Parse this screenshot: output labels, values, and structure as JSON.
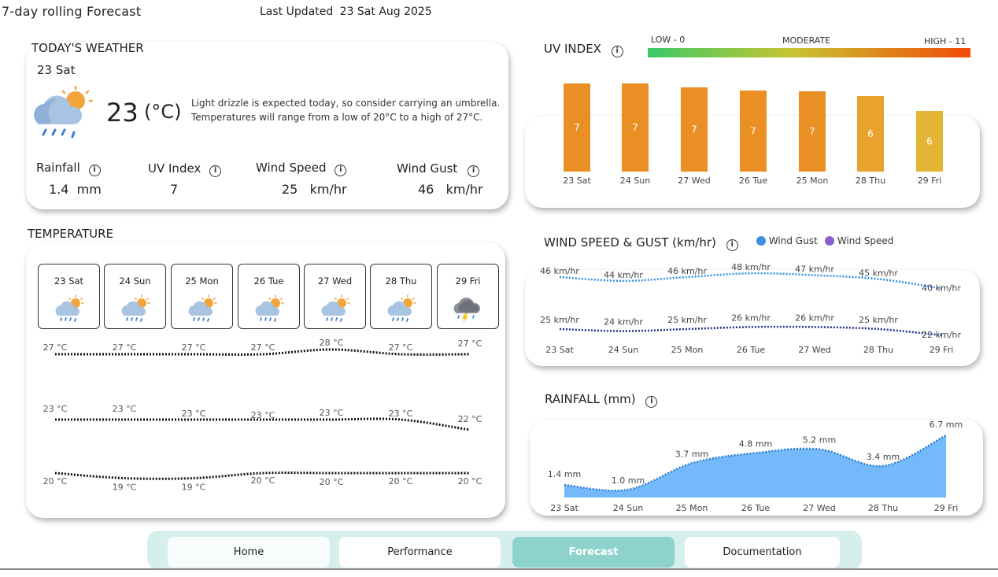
{
  "header": {
    "title": "7-day rolling Forecast",
    "last_updated_label": "Last Updated",
    "last_updated_value": "23 Sat  Aug 2025"
  },
  "today": {
    "section_title": "TODAY'S WEATHER",
    "date": "23 Sat",
    "temp": "23",
    "unit": "(°C)",
    "description_1": "Light drizzle is expected today, so consider carrying an umbrella.",
    "description_2": "Temperatures will range from a low of 20°C to a high of 27°C.",
    "metrics": [
      {
        "label": "Rainfall",
        "value": "1.4",
        "unit": "mm"
      },
      {
        "label": "UV Index",
        "value": "7",
        "unit": ""
      },
      {
        "label": "Wind Speed",
        "value": "25",
        "unit": "km/hr"
      },
      {
        "label": "Wind Gust",
        "value": "46",
        "unit": "km/hr"
      }
    ]
  },
  "temperature": {
    "section_title": "TEMPERATURE",
    "days": [
      "23 Sat",
      "24 Sun",
      "25 Mon",
      "26 Tue",
      "27 Wed",
      "28 Thu",
      "29 Fri"
    ],
    "icons": [
      "rain-sun-icon",
      "rain-sun-icon",
      "rain-sun-icon",
      "rain-sun-icon",
      "rain-sun-icon",
      "rain-sun-icon",
      "thunderstorm-icon"
    ],
    "max": [
      27,
      27,
      27,
      27,
      28,
      27,
      27
    ],
    "mean": [
      23,
      23,
      23,
      23,
      23,
      23,
      22
    ],
    "min": [
      20,
      19,
      19,
      20,
      20,
      20,
      20
    ],
    "max_labels": [
      "27 °C",
      "27 °C",
      "27 °C",
      "27 °C",
      "28 °C",
      "27 °C",
      "27 °C"
    ],
    "mean_labels": [
      "23 °C",
      "23 °C",
      "23 °C",
      "23 °C",
      "23 °C",
      "23 °C",
      "22 °C"
    ],
    "min_labels": [
      "20 °C",
      "19 °C",
      "19 °C",
      "20 °C",
      "20 °C",
      "20 °C",
      "20 °C"
    ]
  },
  "uv": {
    "section_title": "UV INDEX",
    "scale_low": "LOW - 0",
    "scale_mid": "MODERATE",
    "scale_high": "HIGH - 11",
    "colors": {
      "low": "#3cc968",
      "mid": "#c8c431",
      "high": "#f24a08"
    }
  },
  "wind": {
    "section_title": "WIND SPEED & GUST (km/hr)",
    "legend_gust": "Wind Gust",
    "legend_speed": "Wind Speed",
    "colors": {
      "gust": "#3f8fe0",
      "speed": "#8a5fcc",
      "gust_line": "#2f8fe8",
      "speed_line": "#1d2e8f"
    }
  },
  "rain": {
    "section_title": "RAINFALL (mm)",
    "area_color": "#74b9f9",
    "line_color": "#2f7fd0"
  },
  "nav": {
    "items": [
      "Home",
      "Performance",
      "Forecast",
      "Documentation"
    ],
    "active": "Forecast"
  },
  "chart_data": [
    {
      "type": "bar",
      "title": "UV INDEX",
      "categories": [
        "23 Sat",
        "24 Sun",
        "27 Wed",
        "26 Tue",
        "25 Mon",
        "28 Thu",
        "29 Fri"
      ],
      "values": [
        7,
        7,
        7,
        7,
        7,
        6,
        6
      ],
      "labels": [
        "7",
        "7",
        "7",
        "7",
        "7",
        "6",
        "6"
      ],
      "ylim": [
        0,
        7.6
      ]
    },
    {
      "type": "line",
      "title": "WIND SPEED & GUST (km/hr)",
      "categories": [
        "23 Sat",
        "24 Sun",
        "25 Mon",
        "26 Tue",
        "27 Wed",
        "28 Thu",
        "29 Fri"
      ],
      "series": [
        {
          "name": "Wind Gust",
          "values": [
            46,
            44,
            46,
            48,
            47,
            45,
            40
          ],
          "labels": [
            "46 km/hr",
            "44 km/hr",
            "46 km/hr",
            "48 km/hr",
            "47 km/hr",
            "45 km/hr",
            "40 km/hr"
          ]
        },
        {
          "name": "Wind Speed",
          "values": [
            25,
            24,
            25,
            26,
            26,
            25,
            22
          ],
          "labels": [
            "25 km/hr",
            "24 km/hr",
            "25 km/hr",
            "26 km/hr",
            "26 km/hr",
            "25 km/hr",
            "22 km/hr"
          ]
        }
      ]
    },
    {
      "type": "area",
      "title": "RAINFALL (mm)",
      "categories": [
        "23 Sat",
        "24 Sun",
        "25 Mon",
        "26 Tue",
        "27 Wed",
        "28 Thu",
        "29 Fri"
      ],
      "values": [
        1.4,
        1.0,
        3.7,
        4.8,
        5.2,
        3.4,
        6.7
      ],
      "labels": [
        "1.4 mm",
        "1.0 mm",
        "3.7 mm",
        "4.8 mm",
        "5.2 mm",
        "3.4 mm",
        "6.7 mm"
      ],
      "ylim": [
        0,
        6.7
      ]
    }
  ]
}
